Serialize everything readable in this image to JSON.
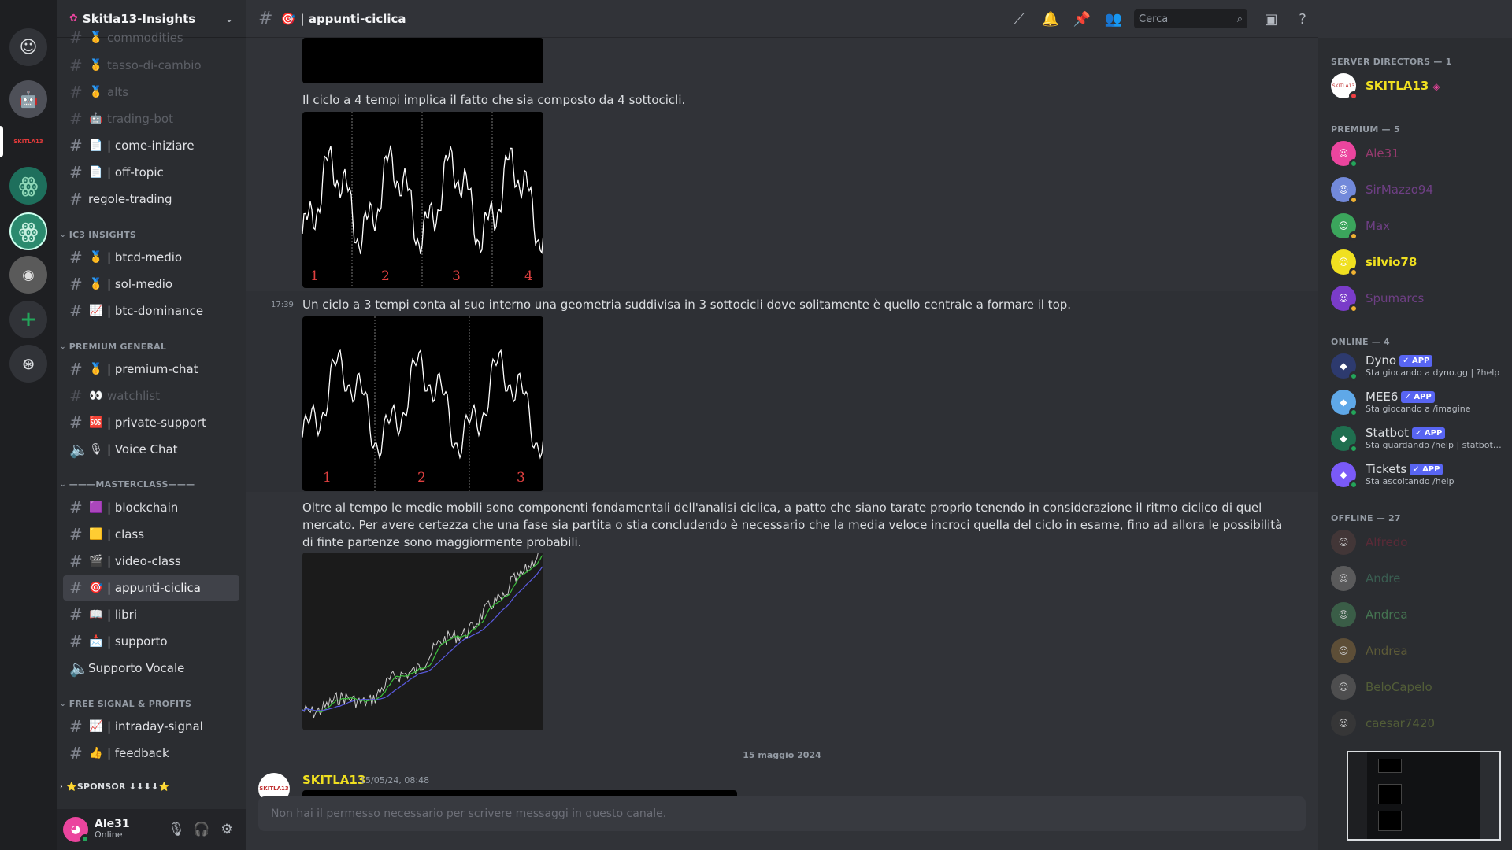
{
  "server": {
    "name": "Skitla13-Insights"
  },
  "servers": [
    {
      "name": "discord-home-icon",
      "color": "#313338",
      "label": "⌂"
    },
    {
      "name": "server-robot",
      "color": "#4e5058",
      "label": "🤖"
    },
    {
      "name": "server-skitla13",
      "color": "#1e1f22",
      "label": "SKITLA13"
    },
    {
      "name": "server-green-1",
      "color": "#1e6f5c",
      "label": "Ϡ"
    },
    {
      "name": "server-green-2",
      "color": "#2b8a6e",
      "label": "Ϡ"
    },
    {
      "name": "server-photo",
      "color": "#555",
      "label": "◉"
    }
  ],
  "sidebar": {
    "channels": [
      {
        "label": "commodities",
        "emoji": "🥇",
        "style": "muted"
      },
      {
        "label": "tasso-di-cambio",
        "emoji": "🥇",
        "style": "muted"
      },
      {
        "label": "alts",
        "emoji": "🥇",
        "style": "muted"
      },
      {
        "label": "trading-bot",
        "emoji": "🤖",
        "style": "muted"
      },
      {
        "label": "| come-iniziare",
        "emoji": "📄",
        "style": "bright"
      },
      {
        "label": "| off-topic",
        "emoji": "📄",
        "style": "bright"
      },
      {
        "label": "regole-trading",
        "emoji": "",
        "style": "bright"
      }
    ],
    "categories": [
      {
        "label": "IC3 INSIGHTS"
      },
      {
        "label": "PREMIUM GENERAL"
      },
      {
        "label": "———MASTERCLASS———"
      },
      {
        "label": "FREE SIGNAL & PROFITS"
      },
      {
        "label": "⭐SPONSOR ⬇⬇⬇⬇⭐"
      }
    ],
    "ic3": [
      {
        "label": "| btcd-medio",
        "emoji": "🥇"
      },
      {
        "label": "| sol-medio",
        "emoji": "🥇"
      },
      {
        "label": "| btc-dominance",
        "emoji": "📈"
      }
    ],
    "premium": [
      {
        "label": "| premium-chat",
        "emoji": "🥇",
        "style": "bright"
      },
      {
        "label": "watchlist",
        "emoji": "👀",
        "style": "muted"
      },
      {
        "label": "| private-support",
        "emoji": "🆘",
        "style": "bright"
      },
      {
        "label": "| Voice Chat",
        "emoji": "🎙",
        "style": "voice"
      }
    ],
    "masterclass": [
      {
        "label": "| blockchain",
        "emoji": "🟪"
      },
      {
        "label": "| class",
        "emoji": "🟨"
      },
      {
        "label": "| video-class",
        "emoji": "🎬"
      },
      {
        "label": "| appunti-ciclica",
        "emoji": "🎯",
        "active": true
      },
      {
        "label": "| libri",
        "emoji": "📖"
      },
      {
        "label": "| supporto",
        "emoji": "📩"
      },
      {
        "label": "Supporto Vocale",
        "emoji": "",
        "voice": true
      }
    ],
    "free": [
      {
        "label": "| intraday-signal",
        "emoji": "📈"
      },
      {
        "label": "| feedback",
        "emoji": "👍"
      }
    ]
  },
  "user": {
    "name": "Ale31",
    "status": "Online"
  },
  "channel": {
    "emoji": "🎯",
    "title": "| appunti-ciclica"
  },
  "search": {
    "placeholder": "Cerca"
  },
  "messages": {
    "text1": "Il ciclo a 4 tempi implica il fatto che sia composto da 4 sottocicli.",
    "time2": "17:39",
    "text2": "Un ciclo a 3 tempi conta al suo interno una geometria suddivisa in 3 sottocicli dove solitamente è quello centrale a formare il top.",
    "text3": "Oltre al tempo le medie mobili sono componenti fondamentali dell'analisi ciclica, a patto che siano tarate proprio tenendo in considerazione il ritmo ciclico di quel mercato. Per avere certezza che una fase sia partita o stia concludendo è necessario che la media veloce incroci quella del ciclo in esame, fino ad allora le possibilità di finte partenze sono maggiormente probabili.",
    "cycle4_labels": [
      "1",
      "2",
      "3",
      "4"
    ],
    "cycle3_labels": [
      "1",
      "2",
      "3"
    ],
    "date_divider": "15 maggio 2024",
    "last_author": "SKITLA13",
    "last_time": "15/05/24, 08:48",
    "input_placeholder": "Non hai il permesso necessario per scrivere messaggi in questo canale."
  },
  "members": {
    "directors_header": "SERVER DIRECTORS — 1",
    "directors": [
      {
        "name": "SKITLA13",
        "color": "#f0e020",
        "badge": "◈"
      }
    ],
    "premium_header": "PREMIUM — 5",
    "premium": [
      {
        "name": "Ale31",
        "color": "#eb459e",
        "avatar": "#eb459e",
        "dim": true
      },
      {
        "name": "SirMazzo94",
        "color": "#a64ec9",
        "avatar": "#7289da",
        "dim": true
      },
      {
        "name": "Max",
        "color": "#a64ec9",
        "avatar": "#3ba55c",
        "dim": true
      },
      {
        "name": "silvio78",
        "color": "#f0e020",
        "avatar": "#f0e020",
        "dim": false
      },
      {
        "name": "Spumarcs",
        "color": "#a64ec9",
        "avatar": "#7a3cc9",
        "dim": true
      }
    ],
    "online_header": "ONLINE — 4",
    "online": [
      {
        "name": "Dyno",
        "activity": "Sta giocando a dyno.gg | ?help",
        "avatar": "#2d3a6e"
      },
      {
        "name": "MEE6",
        "activity": "Sta giocando a /imagine",
        "avatar": "#5fa8e8"
      },
      {
        "name": "Statbot",
        "activity": "Sta guardando /help | statbot.net",
        "avatar": "#1f6f4f"
      },
      {
        "name": "Tickets",
        "activity": "Sta ascoltando /help",
        "avatar": "#7a5af8"
      }
    ],
    "app_label": "✓ APP",
    "offline_header": "OFFLINE — 27",
    "offline": [
      {
        "name": "Alfredo",
        "color": "#6a2a3a",
        "avatar": "#4a3a3a"
      },
      {
        "name": "Andre",
        "color": "#3f6e5c",
        "avatar": "#6a6a6a"
      },
      {
        "name": "Andrea",
        "color": "#4d8c5c",
        "avatar": "#3f6e4f"
      },
      {
        "name": "Andrea",
        "color": "#6e6a3a",
        "avatar": "#6e5a3a"
      },
      {
        "name": "BeloCapelo",
        "color": "#5f6e3a",
        "avatar": "#5a5a5a"
      },
      {
        "name": "caesar7420",
        "color": "#5f6e3a",
        "avatar": "#3a3a3a"
      }
    ]
  },
  "colors": {
    "accent": "#5865f2",
    "online": "#23a55a",
    "idle": "#f0b232",
    "director": "#f0e020"
  }
}
